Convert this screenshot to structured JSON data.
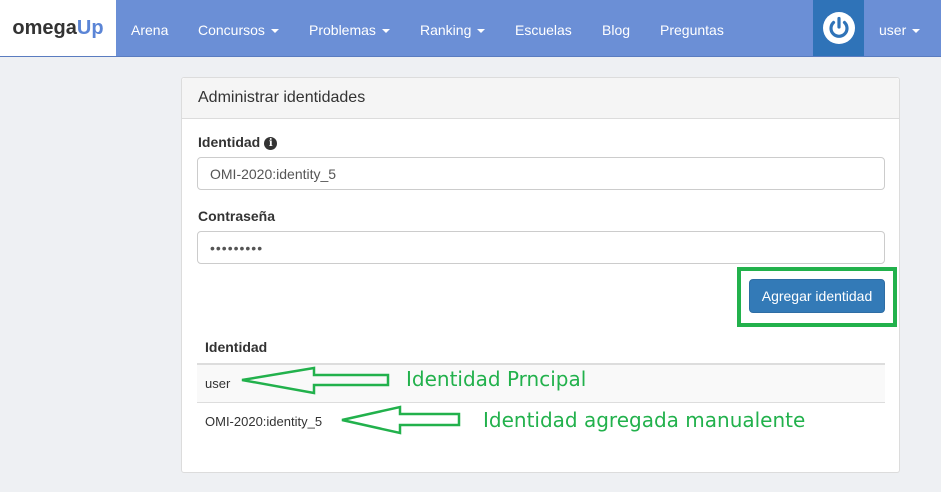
{
  "navbar": {
    "brand_part1": "omega",
    "brand_part2": "Up",
    "items": [
      {
        "label": "Arena"
      },
      {
        "label": "Concursos"
      },
      {
        "label": "Problemas"
      },
      {
        "label": "Ranking"
      },
      {
        "label": "Escuelas"
      },
      {
        "label": "Blog"
      },
      {
        "label": "Preguntas"
      }
    ],
    "user_label": "user",
    "colors": {
      "background": "#6b8fd6",
      "power_box": "#2f73b8"
    }
  },
  "panel": {
    "title": "Administrar identidades",
    "identity_label": "Identidad",
    "identity_value": "OMI-2020:identity_5",
    "password_label": "Contraseña",
    "password_value": "•••••••••",
    "add_button_label": "Agregar identidad",
    "table": {
      "header": "Identidad",
      "rows": [
        {
          "identity": "user"
        },
        {
          "identity": "OMI-2020:identity_5"
        }
      ]
    }
  },
  "annotations": {
    "principal": "Identidad Prncipal",
    "manual": "Identidad agregada manualente",
    "color": "#22b14c"
  }
}
